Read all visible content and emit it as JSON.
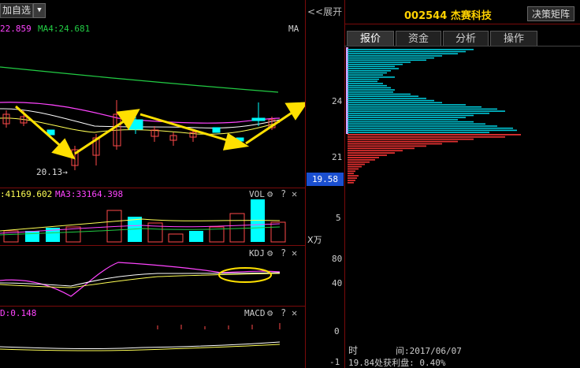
{
  "toolbar": {
    "add_fav_label": "加自选",
    "dropdown_glyph": "▼",
    "expand_label": "<<展开"
  },
  "main_chart": {
    "ma_header": {
      "ma_left": "22.859",
      "ma4": "MA4:24.681",
      "tag": "MA"
    },
    "low_annotation": "20.13→",
    "axis_labels": {
      "p24": "24",
      "p21": "21",
      "current_price": "19.58"
    }
  },
  "volume_panel": {
    "header": {
      "left": ":41169.602",
      "ma3": "MA3:33164.398",
      "name": "VOL"
    },
    "axis_labels": {
      "v5": "5",
      "unit": "X万"
    }
  },
  "kdj_panel": {
    "header": {
      "name": "KDJ"
    },
    "axis_labels": {
      "k80": "80",
      "k40": "40"
    }
  },
  "macd_panel": {
    "header": {
      "left": "D:0.148",
      "name": "MACD"
    },
    "axis_labels": {
      "m0": "0",
      "m_neg1": "-1"
    }
  },
  "stock": {
    "code": "002544",
    "name": "杰赛科技"
  },
  "right_panel": {
    "decision_button": "决策矩阵",
    "tabs": [
      "报价",
      "资金",
      "分析",
      "操作"
    ],
    "info_time_label": "时",
    "info_time_value": "间:2017/06/07",
    "info_profit": "19.84处获利盘: 0.40%"
  },
  "colors": {
    "up": "#ff4a4a",
    "down": "#00ffff",
    "ma_yellow": "#ffff55",
    "ma_magenta": "#ff44ff",
    "ma_green": "#22cc44",
    "arrow": "#ffe000",
    "divider": "#7a0b0b"
  },
  "icons": [
    "gear-icon",
    "help-icon",
    "close-icon"
  ]
}
